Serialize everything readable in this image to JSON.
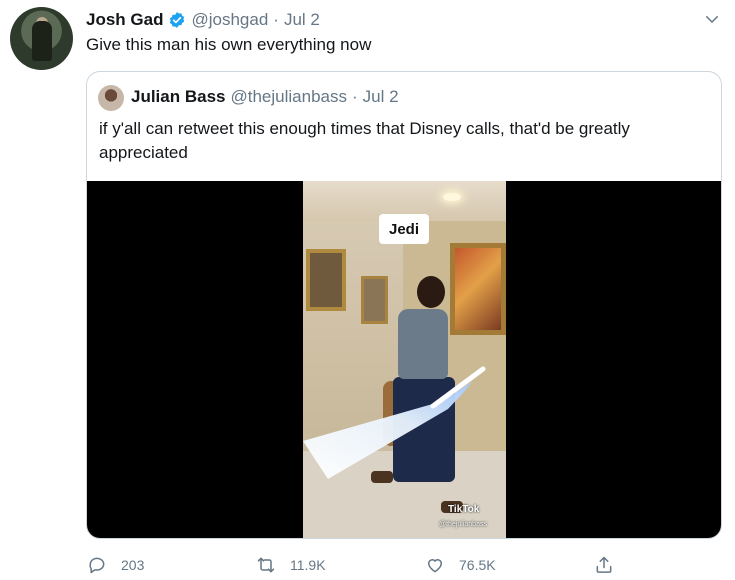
{
  "tweet": {
    "author_name": "Josh Gad",
    "handle": "@joshgad",
    "separator": "·",
    "date": "Jul 2",
    "text": "Give this man his own everything now",
    "verified_icon": "verified-badge-icon",
    "menu_icon": "chevron-down-icon"
  },
  "quote": {
    "author_name": "Julian Bass",
    "handle": "@thejulianbass",
    "separator": "·",
    "date": "Jul 2",
    "text": "if y'all can retweet this enough times that Disney calls, that'd be greatly appreciated",
    "video": {
      "overlay_label": "Jedi",
      "watermark": "TikTok",
      "watermark_user": "@thejulianbass"
    }
  },
  "actions": {
    "reply_count": "203",
    "retweet_count": "11.9K",
    "like_count": "76.5K",
    "reply_icon": "reply-icon",
    "retweet_icon": "retweet-icon",
    "like_icon": "heart-icon",
    "share_icon": "share-icon"
  },
  "colors": {
    "text": "#14171a",
    "secondary": "#657786",
    "verified": "#1da1f2",
    "border": "#ccd6dd"
  }
}
